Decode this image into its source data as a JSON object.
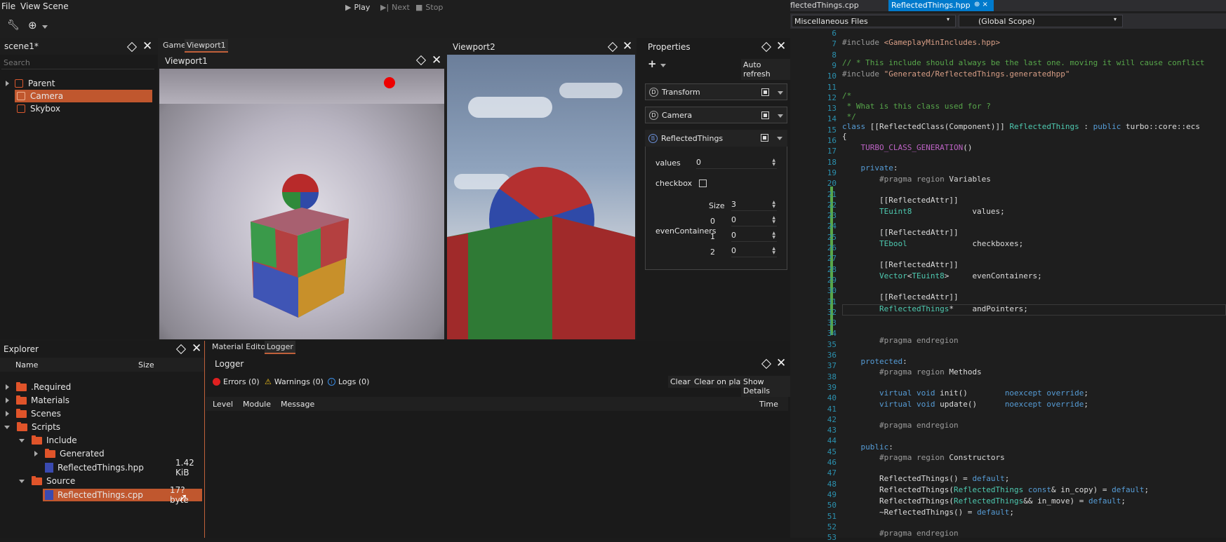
{
  "menu": {
    "file": "File",
    "view": "View",
    "scene": "Scene"
  },
  "playbar": {
    "play": "Play",
    "next": "Next",
    "stop": "Stop"
  },
  "scene": {
    "title": "scene1*",
    "search_placeholder": "Search",
    "items": [
      "Parent",
      "Camera",
      "Skybox"
    ]
  },
  "viewport_tabs": {
    "game": "Game",
    "viewport1": "Viewport1"
  },
  "viewport1": {
    "title": "Viewport1"
  },
  "viewport2": {
    "title": "Viewport2"
  },
  "properties": {
    "title": "Properties",
    "auto_refresh": "Auto refresh",
    "add": "+",
    "components": [
      {
        "icon": "D",
        "name": "Transform"
      },
      {
        "icon": "D",
        "name": "Camera"
      },
      {
        "icon": "B",
        "name": "ReflectedThings"
      }
    ],
    "fields": {
      "values_label": "values",
      "values_value": "0",
      "checkbox_label": "checkbox",
      "even_label": "evenContainers",
      "size_label": "Size",
      "size_value": "3",
      "items": [
        {
          "i": "0",
          "v": "0"
        },
        {
          "i": "1",
          "v": "0"
        },
        {
          "i": "2",
          "v": "0"
        }
      ]
    }
  },
  "explorer": {
    "title": "Explorer",
    "col_name": "Name",
    "col_size": "Size",
    "items": [
      {
        "name": ".Required"
      },
      {
        "name": "Materials"
      },
      {
        "name": "Scenes"
      },
      {
        "name": "Scripts"
      },
      {
        "name": "Include"
      },
      {
        "name": "Generated"
      },
      {
        "name": "ReflectedThings.hpp",
        "size": "1.42 KiB"
      },
      {
        "name": "Source"
      },
      {
        "name": "ReflectedThings.cpp",
        "size": "17? byte"
      }
    ]
  },
  "bottom_tabs": {
    "material_editor": "Material Editor",
    "logger": "Logger"
  },
  "logger": {
    "title": "Logger",
    "errors": "Errors (0)",
    "warnings": "Warnings (0)",
    "logs": "Logs (0)",
    "clear": "Clear",
    "clear_on_play": "Clear on play",
    "show_details": "Show Details",
    "columns": {
      "level": "Level",
      "module": "Module",
      "message": "Message",
      "time": "Time"
    }
  },
  "editor": {
    "tab_cpp": "flectedThings.cpp",
    "tab_hpp": "ReflectedThings.hpp",
    "tab_pin": "⊕ ×",
    "scope_left": "Miscellaneous Files",
    "scope_right": "(Global Scope)",
    "line_numbers": [
      "6",
      "7",
      "8",
      "9",
      "10",
      "11",
      "12",
      "13",
      "14",
      "15",
      "16",
      "17",
      "18",
      "19",
      "20",
      "21",
      "22",
      "23",
      "24",
      "25",
      "26",
      "27",
      "28",
      "29",
      "30",
      "31",
      "32",
      "33",
      "34",
      "35",
      "36",
      "37",
      "38",
      "39",
      "40",
      "41",
      "42",
      "43",
      "44",
      "45",
      "46",
      "47",
      "48",
      "49",
      "50",
      "51",
      "52",
      "53"
    ]
  },
  "colors": {
    "accent": "#c0603a",
    "selected": "#c0572e",
    "folder": "#e0542a",
    "tab_blue": "#007acc"
  }
}
